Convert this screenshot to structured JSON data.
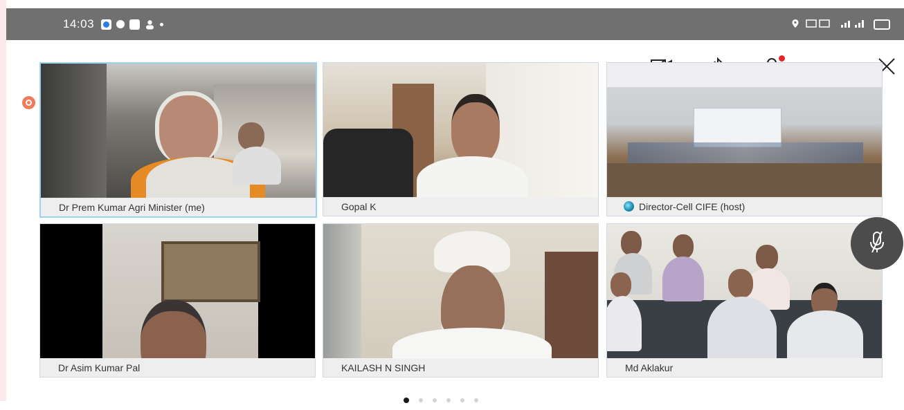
{
  "status_bar": {
    "time": "14:03",
    "left_icons": [
      "app-notification-icon",
      "record-icon",
      "video-icon",
      "contacts-icon"
    ],
    "right_text": "",
    "right_icons": [
      "location-icon",
      "data-icon",
      "signal-icon",
      "battery-icon"
    ]
  },
  "toolbar": {
    "icons": [
      "camera-off-icon",
      "bluetooth-icon",
      "participants-icon",
      "more-icon",
      "close-icon"
    ],
    "notification_color": "#e5242a"
  },
  "participants": [
    {
      "name": "Dr Prem Kumar Agri Minister (me)",
      "role": "me"
    },
    {
      "name": "Gopal K",
      "role": "participant"
    },
    {
      "name": "Director-Cell CIFE (host)",
      "role": "host"
    },
    {
      "name": "Dr Asim Kumar Pal",
      "role": "participant"
    },
    {
      "name": "KAILASH N SINGH",
      "role": "participant"
    },
    {
      "name": "Md Aklakur",
      "role": "participant"
    }
  ],
  "mic": {
    "state": "muted",
    "icon": "mic-muted-icon"
  },
  "pagination": {
    "pages": 6,
    "active": 1
  },
  "colors": {
    "status_bar": "#707070",
    "active_tile_border": "#9ed0ef",
    "mic_button": "#4c4c4c"
  }
}
